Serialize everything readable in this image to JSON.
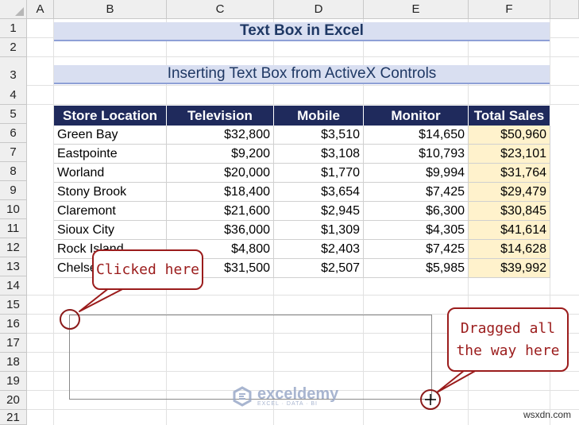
{
  "columns": [
    "A",
    "B",
    "C",
    "D",
    "E",
    "F"
  ],
  "rows": [
    "1",
    "2",
    "3",
    "4",
    "5",
    "6",
    "7",
    "8",
    "9",
    "10",
    "11",
    "12",
    "13",
    "14",
    "15",
    "16",
    "17",
    "18",
    "19",
    "20",
    "21"
  ],
  "title": "Text Box in Excel",
  "subtitle": "Inserting Text Box from ActiveX Controls",
  "table": {
    "headers": [
      "Store Location",
      "Television",
      "Mobile",
      "Monitor",
      "Total Sales"
    ],
    "rows": [
      [
        "Green Bay",
        "$32,800",
        "$3,510",
        "$14,650",
        "$50,960"
      ],
      [
        "Eastpointe",
        "$9,200",
        "$3,108",
        "$10,793",
        "$23,101"
      ],
      [
        "Worland",
        "$20,000",
        "$1,770",
        "$9,994",
        "$31,764"
      ],
      [
        "Stony Brook",
        "$18,400",
        "$3,654",
        "$7,425",
        "$29,479"
      ],
      [
        "Claremont",
        "$21,600",
        "$2,945",
        "$6,300",
        "$30,845"
      ],
      [
        "Sioux City",
        "$36,000",
        "$1,309",
        "$4,305",
        "$41,614"
      ],
      [
        "Rock Island",
        "$4,800",
        "$2,403",
        "$7,425",
        "$14,628"
      ],
      [
        "Chelsea",
        "$31,500",
        "$2,507",
        "$5,985",
        "$39,992"
      ]
    ]
  },
  "callouts": {
    "clicked": "Clicked here",
    "dragged_line1": "Dragged all",
    "dragged_line2": "the way here"
  },
  "watermark": {
    "name": "exceldemy",
    "tagline": "EXCEL · DATA · BI"
  },
  "site_mark": "wsxdn.com",
  "colors": {
    "header_fill": "#1f2a5c",
    "banner_fill": "#d9dff1",
    "total_fill": "#fff2cc",
    "callout_red": "#9b1c1c"
  }
}
